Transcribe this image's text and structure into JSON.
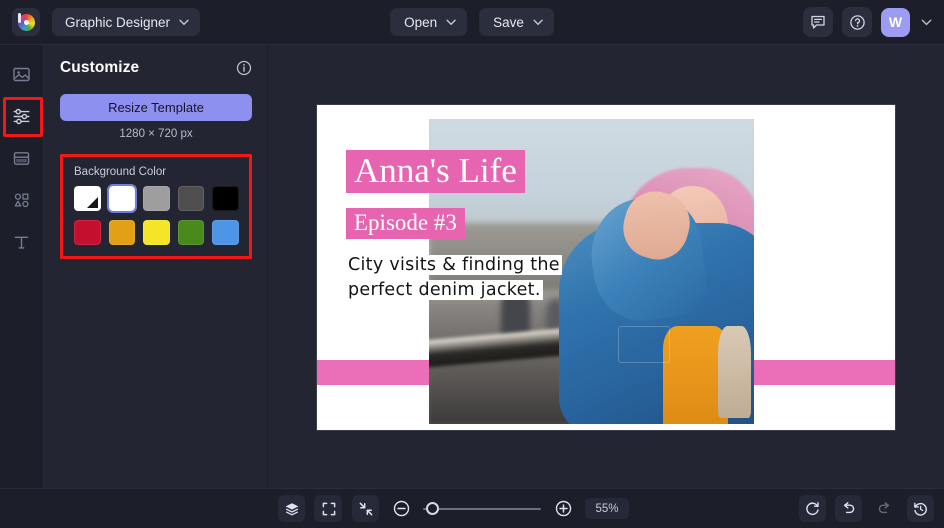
{
  "app": {
    "logo_icon": "color-wheel-logo",
    "document_name": "Graphic Designer",
    "accent": "#8e90f0",
    "panel_bg": "#232532",
    "rail_bg": "#1c1e29",
    "highlight_outline": "#f21818"
  },
  "topbar": {
    "open_label": "Open",
    "save_label": "Save",
    "comment_icon": "comment-icon",
    "help_icon": "help-circle-icon",
    "avatar_initial": "W",
    "chevron_icon": "chevron-down-icon"
  },
  "rail": {
    "items": [
      {
        "name": "image",
        "icon": "image-icon",
        "active": false
      },
      {
        "name": "customize",
        "icon": "sliders-icon",
        "active": true
      },
      {
        "name": "layout",
        "icon": "layout-icon",
        "active": false
      },
      {
        "name": "shapes",
        "icon": "shapes-icon",
        "active": false
      },
      {
        "name": "text",
        "icon": "text-icon",
        "active": false
      }
    ]
  },
  "panel": {
    "title": "Customize",
    "info_icon": "info-circle-icon",
    "resize_label": "Resize Template",
    "dimensions": "1280 × 720 px",
    "background_color": {
      "label": "Background Color",
      "swatches": [
        {
          "name": "transparent",
          "hex": "#ffffff",
          "has_triangle": true,
          "selected": false
        },
        {
          "name": "white",
          "hex": "#ffffff",
          "has_triangle": false,
          "selected": true
        },
        {
          "name": "gray",
          "hex": "#9e9e9e",
          "has_triangle": false,
          "selected": false
        },
        {
          "name": "dark-gray",
          "hex": "#4e4e4e",
          "has_triangle": false,
          "selected": false
        },
        {
          "name": "black",
          "hex": "#000000",
          "has_triangle": false,
          "selected": false
        },
        {
          "name": "crimson",
          "hex": "#c4102e",
          "has_triangle": false,
          "selected": false
        },
        {
          "name": "amber",
          "hex": "#e2a016",
          "has_triangle": false,
          "selected": false
        },
        {
          "name": "yellow",
          "hex": "#f5e527",
          "has_triangle": false,
          "selected": false
        },
        {
          "name": "green",
          "hex": "#4a8a1d",
          "has_triangle": false,
          "selected": false
        },
        {
          "name": "blue",
          "hex": "#4f95e6",
          "has_triangle": false,
          "selected": false
        }
      ]
    }
  },
  "canvas": {
    "title": "Anna's Life",
    "subtitle": "Episode #3",
    "body_line1": "City visits & finding the",
    "body_line2": "perfect denim jacket.",
    "highlight_color": "#e764b0",
    "bar_color": "#ea6fb8",
    "background": "#ffffff",
    "photo_alt": "woman-with-pink-hair-in-denim-jacket"
  },
  "bottombar": {
    "layers_icon": "layers-icon",
    "grid_icon": "grid-icon",
    "fullscreen_icon": "fullscreen-icon",
    "fit-screen_icon": "fit-screen-icon",
    "zoom_out_icon": "zoom-out-icon",
    "zoom_in_icon": "zoom-in-icon",
    "zoom_level": "55%",
    "reset_icon": "reset-icon",
    "undo_icon": "undo-icon",
    "redo_icon": "redo-icon",
    "history_icon": "history-icon"
  }
}
